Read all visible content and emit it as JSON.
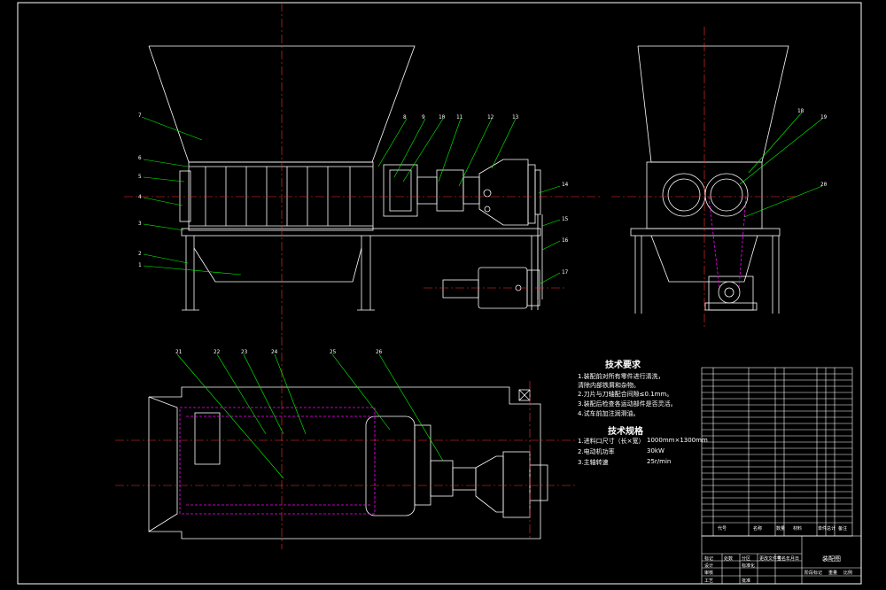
{
  "tech_requirements": {
    "title": "技术要求",
    "items": [
      "1.装配前对所有零件进行清洗，",
      "  清除内部铁屑和杂物。",
      "2.刀片与刀轴配合间隙≤0.1mm。",
      "3.装配后检查各运动部件是否灵活。",
      "4.试车前加注润滑油。"
    ]
  },
  "tech_specs": {
    "title": "技术规格",
    "items": [
      {
        "label": "1.进料口尺寸（长×宽）",
        "value": "1000mm×1300mm"
      },
      {
        "label": "2.电动机功率",
        "value": "30kW"
      },
      {
        "label": "3.主轴转速",
        "value": "25r/min"
      }
    ]
  },
  "part_labels": [
    "1",
    "2",
    "3",
    "4",
    "5",
    "6",
    "7",
    "8",
    "9",
    "10",
    "11",
    "12",
    "13",
    "14",
    "15",
    "16",
    "17",
    "18",
    "19",
    "20",
    "21",
    "22",
    "23",
    "24",
    "25",
    "26"
  ],
  "title_block": {
    "header": [
      "代号",
      "名称",
      "数量",
      "材料",
      "单件",
      "总计",
      "备注"
    ],
    "drawing_name": "装配图",
    "bottom_fields": [
      "标记",
      "处数",
      "分区",
      "更改文件号",
      "签名",
      "年月日",
      "设计",
      "审核",
      "工艺",
      "批准",
      "标准化",
      "阶段标记",
      "重量",
      "比例"
    ]
  },
  "colors": {
    "line": "#ffffff",
    "center": "#ff3030",
    "leader": "#00ff00",
    "hidden": "#ff00ff",
    "frame": "#ffffff"
  }
}
